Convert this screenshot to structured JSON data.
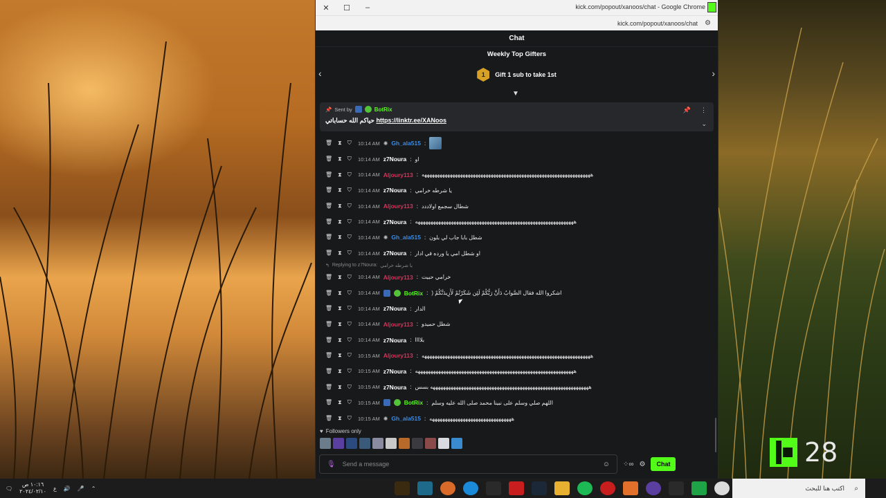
{
  "window": {
    "title": "kick.com/popout/xanoos/chat - Google Chrome",
    "url": "kick.com/popout/xanoos/chat"
  },
  "chat": {
    "header": "Chat",
    "gifters_title": "Weekly Top Gifters",
    "gift_rank": "1",
    "gift_text": "Gift 1 sub to take 1st",
    "pinned": {
      "sent_by": "Sent by",
      "author": "BotRix",
      "message_prefix": "حياكم الله حساباتي",
      "link": "https://linktr.ee/XANoos"
    },
    "messages": [
      {
        "time": "10:14 AM",
        "user": "Gh_ala515",
        "color": "#3b8be6",
        "badge": "spider",
        "text": ""
      },
      {
        "time": "10:14 AM",
        "user": "z7Noura",
        "color": "#ffffff",
        "badge": "",
        "text": "او"
      },
      {
        "time": "10:14 AM",
        "user": "Aljoury113",
        "color": "#e0305a",
        "badge": "",
        "text": "ههههههههههههههههههههههههههههههههههههههههههههههههههههههههههههههههههه"
      },
      {
        "time": "10:14 AM",
        "user": "z7Noura",
        "color": "#ffffff",
        "badge": "",
        "text": "يا شرطه خرامي"
      },
      {
        "time": "10:14 AM",
        "user": "Aljoury113",
        "color": "#e0305a",
        "badge": "",
        "text": "شطال سجمع اولاددد"
      },
      {
        "time": "10:14 AM",
        "user": "z7Noura",
        "color": "#ffffff",
        "badge": "",
        "text": "ههههههههههههههههههههههههههههههههههههههههههههههههههههههههههههههه"
      },
      {
        "time": "10:14 AM",
        "user": "Gh_ala515",
        "color": "#3b8be6",
        "badge": "spider",
        "text": "شطل بابا جاب لي بلون"
      },
      {
        "time": "10:14 AM",
        "user": "z7Noura",
        "color": "#ffffff",
        "badge": "",
        "text": "او شطل امي يا ورده في ادار"
      }
    ],
    "reply_label": "Replying to z7Noura:",
    "reply_quote": "يا شرطه خرامي",
    "messages2": [
      {
        "time": "10:14 AM",
        "user": "Aljoury113",
        "color": "#e0305a",
        "badge": "",
        "text": "خرامي حبيت"
      },
      {
        "time": "10:14 AM",
        "user": "BotRix",
        "color": "#53fc18",
        "badge": "bot",
        "text": "اشكروا الله فقال الصَّوابُ دَأَنَّ رَبُّكُمْ لَئِن شَكَرْتُمْ لَأَزِيدَنَّكُمْ ("
      },
      {
        "time": "10:14 AM",
        "user": "z7Noura",
        "color": "#ffffff",
        "badge": "",
        "text": "الدار"
      },
      {
        "time": "10:14 AM",
        "user": "Aljoury113",
        "color": "#e0305a",
        "badge": "",
        "text": "شطل حميدو"
      },
      {
        "time": "10:14 AM",
        "user": "z7Noura",
        "color": "#ffffff",
        "badge": "",
        "text": "بلاااا"
      },
      {
        "time": "10:15 AM",
        "user": "Aljoury113",
        "color": "#e0305a",
        "badge": "",
        "text": "ههههههههههههههههههههههههههههههههههههههههههههههههههههههههههههههههههه"
      },
      {
        "time": "10:15 AM",
        "user": "z7Noura",
        "color": "#ffffff",
        "badge": "",
        "text": "ههههههههههههههههههههههههههههههههههههههههههههههههههههههههههههههه"
      },
      {
        "time": "10:15 AM",
        "user": "z7Noura",
        "color": "#ffffff",
        "badge": "",
        "text": "ههههههههههههههههههههههههههههههههههههههههههههههههههههههههههههههه بسس"
      },
      {
        "time": "10:15 AM",
        "user": "BotRix",
        "color": "#53fc18",
        "badge": "bot",
        "text": "اللهم صلي وسلم على نبينا محمد صلى الله عليه وسلم"
      },
      {
        "time": "10:15 AM",
        "user": "Gh_ala515",
        "color": "#3b8be6",
        "badge": "spider",
        "text": "ههههههههههههههههههههههههههههههههه"
      }
    ],
    "followers_only": "Followers only",
    "input_placeholder": "Send a message",
    "chat_button": "Chat"
  },
  "overlay": {
    "kick_viewers": "28"
  },
  "taskbar": {
    "time": "١٠:١٦ ص",
    "date": "٢٠٢٤/٠٢/١٠",
    "lang": "ع",
    "search_placeholder": "اكتب هنا للبحث"
  }
}
